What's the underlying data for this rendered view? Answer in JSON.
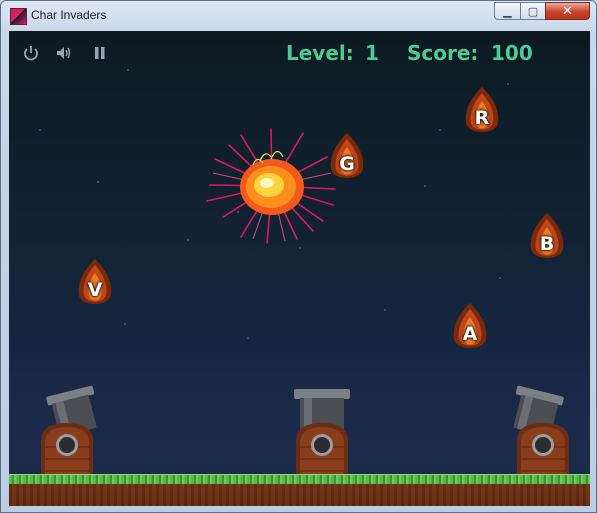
{
  "window": {
    "title": "Char Invaders",
    "minimize_glyph": "▁",
    "maximize_glyph": "▢",
    "close_glyph": "✕"
  },
  "hud": {
    "level_label": "Level:",
    "level_value": "1",
    "score_label": "Score:",
    "score_value": "100",
    "icons": [
      "power-icon",
      "speaker-icon",
      "pause-icon"
    ]
  },
  "meteors": [
    {
      "letter": "R"
    },
    {
      "letter": "G"
    },
    {
      "letter": "B"
    },
    {
      "letter": "V"
    },
    {
      "letter": "A"
    }
  ],
  "cannons": [
    "left",
    "middle",
    "right"
  ],
  "colors": {
    "hud_text": "#4ecb93",
    "sky_top": "#0d1a22",
    "sky_bottom": "#1b2b4c",
    "grass": "#59b84a",
    "dirt": "#6a2f14"
  }
}
